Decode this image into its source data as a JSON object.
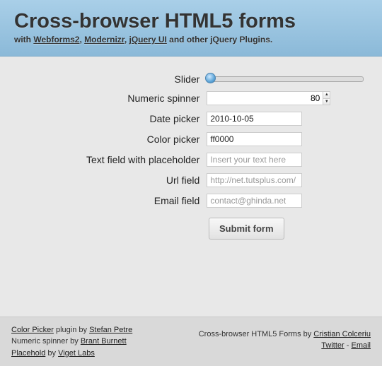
{
  "header": {
    "title": "Cross-browser HTML5 forms",
    "subtitle_prefix": "with ",
    "link1": "Webforms2",
    "sep1": ", ",
    "link2": "Modernizr",
    "sep2": ", ",
    "link3": "jQuery UI",
    "subtitle_suffix": " and other jQuery Plugins."
  },
  "form": {
    "slider_label": "Slider",
    "spinner_label": "Numeric spinner",
    "spinner_value": "80",
    "date_label": "Date picker",
    "date_value": "2010-10-05",
    "color_label": "Color picker",
    "color_value": "ff0000",
    "text_label": "Text field with placeholder",
    "text_placeholder": "Insert your text here",
    "url_label": "Url field",
    "url_placeholder": "http://net.tutsplus.com/",
    "email_label": "Email field",
    "email_placeholder": "contact@ghinda.net",
    "submit_label": "Submit form"
  },
  "footer": {
    "l1_a": "Color Picker",
    "l1_m": " plugin by ",
    "l1_b": "Stefan Petre",
    "l2_m": "Numeric spinner by ",
    "l2_a": "Brant Burnett",
    "l3_a": "Placehold",
    "l3_m": " by ",
    "l3_b": "Viget Labs",
    "r1_m": "Cross-browser HTML5 Forms by ",
    "r1_a": "Cristian Colceriu",
    "r2_a": "Twitter",
    "r2_m": " - ",
    "r2_b": "Email"
  }
}
